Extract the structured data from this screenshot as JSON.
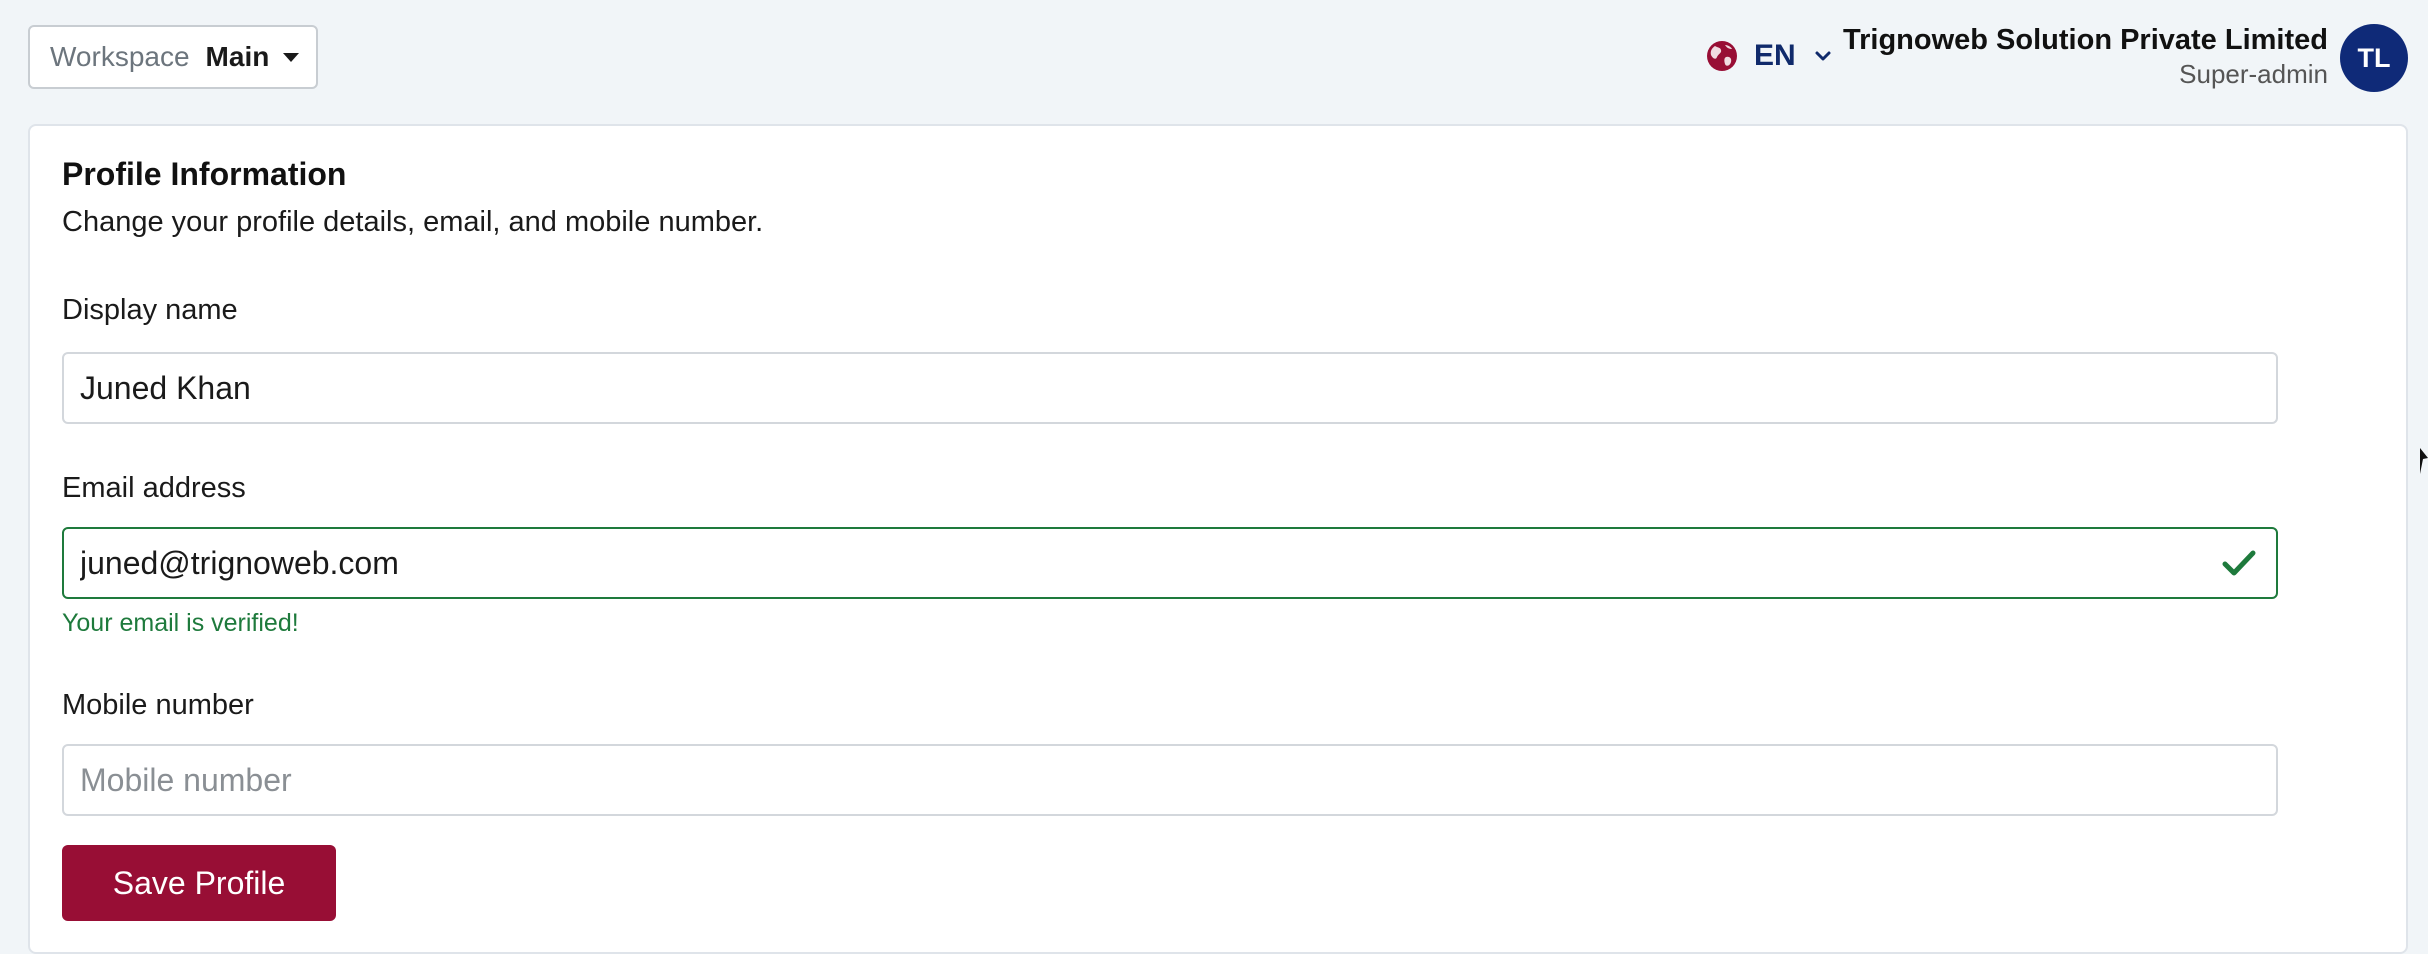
{
  "header": {
    "workspace": {
      "label": "Workspace",
      "value": "Main"
    },
    "language": {
      "code": "EN",
      "globe_color": "#980e35",
      "text_color": "#102a6b"
    },
    "account": {
      "org_name": "Trignoweb Solution Private Limited",
      "role": "Super-admin",
      "initials": "TL",
      "avatar_color": "#0f2a78"
    }
  },
  "profile": {
    "title": "Profile Information",
    "subtitle": "Change your profile details, email, and mobile number.",
    "display_name": {
      "label": "Display name",
      "value": "Juned Khan"
    },
    "email": {
      "label": "Email address",
      "value": "juned@trignoweb.com",
      "status": "Your email is verified!",
      "status_color": "#1e7a3c"
    },
    "mobile": {
      "label": "Mobile number",
      "value": "",
      "placeholder": "Mobile number"
    },
    "save_label": "Save Profile",
    "save_color": "#980e35"
  }
}
